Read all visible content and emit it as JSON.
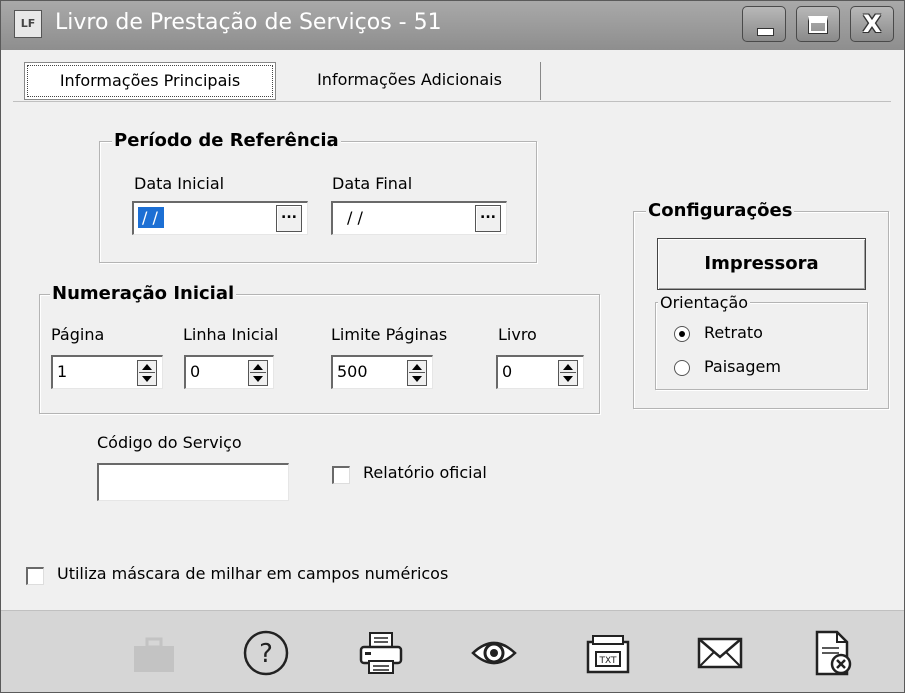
{
  "window": {
    "title": "Livro de Prestação de Serviços - 51",
    "icon_label": "LF",
    "controls": [
      "minimize-icon",
      "maximize-icon",
      "close-icon"
    ],
    "close_glyph": "X"
  },
  "tabs": [
    {
      "label": "Informações Principais",
      "active": true
    },
    {
      "label": "Informações Adicionais",
      "active": false
    }
  ],
  "periodo": {
    "legend": "Período de Referência",
    "data_inicial_label": "Data Inicial",
    "data_inicial_value": "/ /",
    "data_final_label": "Data Final",
    "data_final_value": "/ /",
    "lookup_glyph": "..."
  },
  "numeracao": {
    "legend": "Numeração Inicial",
    "pagina_label": "Página",
    "pagina_value": "1",
    "linha_label": "Linha Inicial",
    "linha_value": "0",
    "limite_label": "Limite Páginas",
    "limite_value": "500",
    "livro_label": "Livro",
    "livro_value": "0"
  },
  "codigo_servico": {
    "label": "Código do Serviço",
    "value": ""
  },
  "relatorio_oficial": {
    "label": "Relatório oficial",
    "checked": false
  },
  "mascara_milhar": {
    "label": "Utiliza máscara de milhar em campos numéricos",
    "checked": false
  },
  "configuracoes": {
    "legend": "Configurações",
    "printer_button": "Impressora",
    "orientacao_legend": "Orientação",
    "options": [
      {
        "label": "Retrato",
        "selected": true
      },
      {
        "label": "Paisagem",
        "selected": false
      }
    ]
  },
  "toolbar": {
    "icons": [
      "briefcase-icon",
      "help-icon",
      "printer-icon",
      "preview-icon",
      "export-icon",
      "email-icon",
      "cancel-document-icon"
    ]
  },
  "colors": {
    "titlebar": "#9b9b9b",
    "selection": "#1c6fd4",
    "toolbar": "#d6d6d6",
    "window": "#f0f0f0"
  }
}
